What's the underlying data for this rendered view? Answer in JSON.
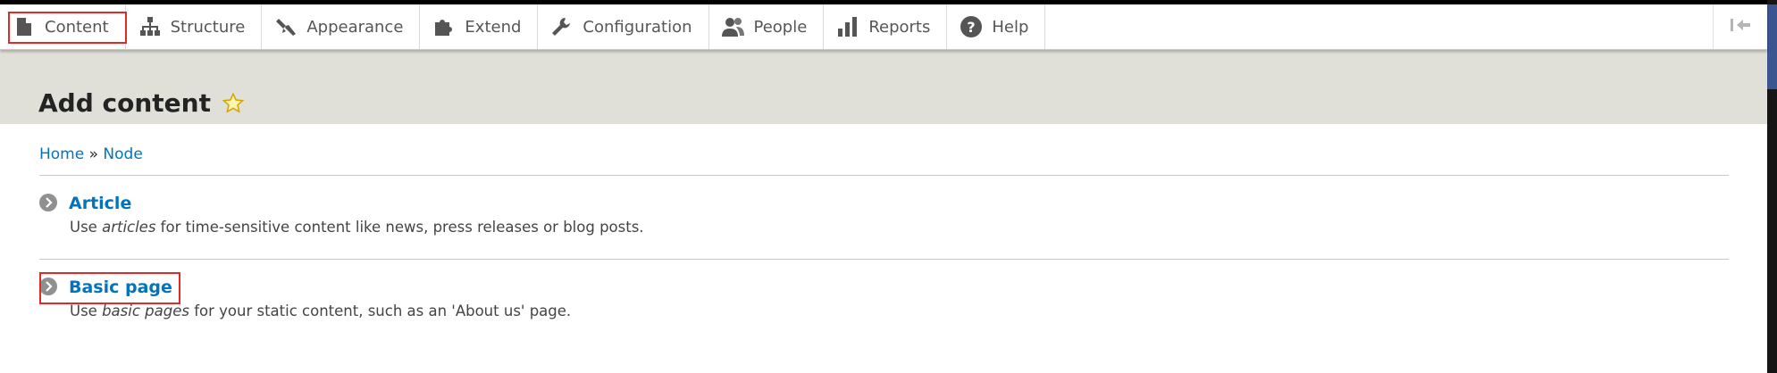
{
  "toolbar": {
    "items": [
      {
        "label": "Content",
        "icon": "document-icon"
      },
      {
        "label": "Structure",
        "icon": "sitemap-icon"
      },
      {
        "label": "Appearance",
        "icon": "paintbrush-icon"
      },
      {
        "label": "Extend",
        "icon": "puzzle-icon"
      },
      {
        "label": "Configuration",
        "icon": "wrench-icon"
      },
      {
        "label": "People",
        "icon": "people-icon"
      },
      {
        "label": "Reports",
        "icon": "bar-chart-icon"
      },
      {
        "label": "Help",
        "icon": "help-icon"
      }
    ],
    "collapse_icon": "collapse-toolbar-icon"
  },
  "page": {
    "title": "Add content"
  },
  "breadcrumb": {
    "home": "Home",
    "separator": "»",
    "node": "Node"
  },
  "content_types": [
    {
      "title": "Article",
      "desc_before": "Use ",
      "desc_em": "articles",
      "desc_after": " for time-sensitive content like news, press releases or blog posts."
    },
    {
      "title": "Basic page",
      "desc_before": "Use ",
      "desc_em": "basic pages",
      "desc_after": " for your static content, such as an 'About us' page."
    }
  ],
  "colors": {
    "link": "#0074bd",
    "header_band": "#e0e0d8",
    "highlight": "#e02a2a"
  }
}
